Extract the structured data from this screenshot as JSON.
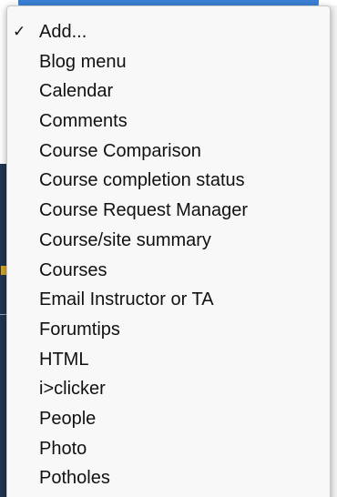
{
  "dropdown": {
    "selected_index": 0,
    "items": [
      {
        "label": "Add..."
      },
      {
        "label": "Blog menu"
      },
      {
        "label": "Calendar"
      },
      {
        "label": "Comments"
      },
      {
        "label": "Course Comparison"
      },
      {
        "label": "Course completion status"
      },
      {
        "label": "Course Request Manager"
      },
      {
        "label": "Course/site summary"
      },
      {
        "label": "Courses"
      },
      {
        "label": "Email Instructor or TA"
      },
      {
        "label": "Forumtips"
      },
      {
        "label": "HTML"
      },
      {
        "label": "i>clicker"
      },
      {
        "label": "People"
      },
      {
        "label": "Photo"
      },
      {
        "label": "Potholes"
      }
    ],
    "check_glyph": "✓"
  },
  "colors": {
    "menu_background": "#f8f8f8",
    "text": "#111111",
    "background_bar": "#3b7fd6",
    "background_sidebar": "#1f3552"
  }
}
